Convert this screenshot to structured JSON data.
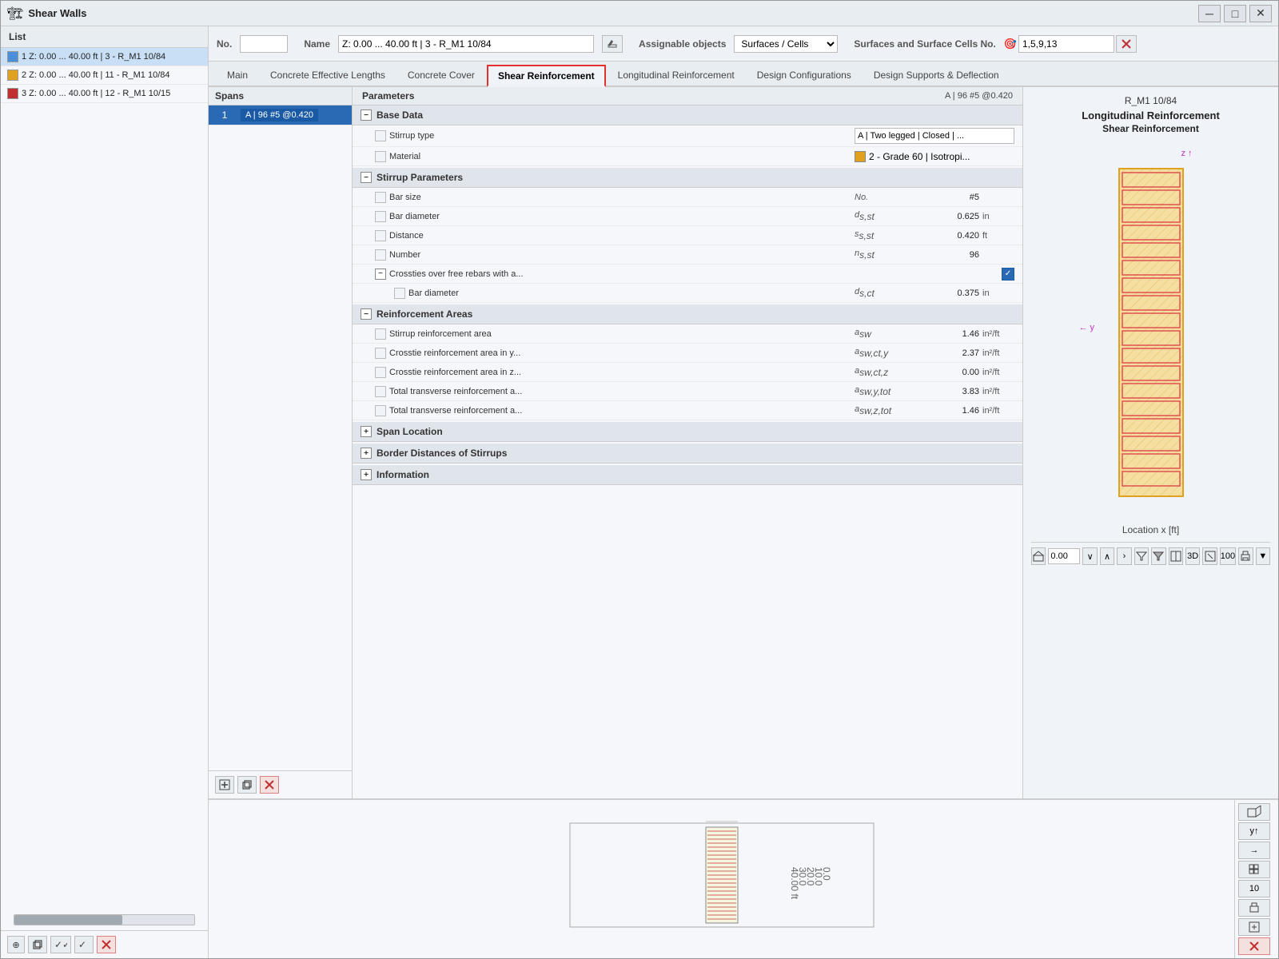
{
  "window": {
    "title": "Shear Walls",
    "icon": "🏗"
  },
  "titlebar_controls": {
    "minimize": "─",
    "maximize": "□",
    "close": "✕"
  },
  "top_bar": {
    "no_label": "No.",
    "name_label": "Name",
    "name_value": "Z: 0.00 ... 40.00 ft | 3 - R_M1 10/84",
    "assignable_label": "Assignable objects",
    "assignable_value": "Surfaces / Cells",
    "surfaces_label": "Surfaces and Surface Cells No.",
    "surfaces_value": "1,5,9,13"
  },
  "tabs": [
    {
      "id": "main",
      "label": "Main"
    },
    {
      "id": "concrete_effective",
      "label": "Concrete Effective Lengths"
    },
    {
      "id": "concrete_cover",
      "label": "Concrete Cover"
    },
    {
      "id": "shear_reinforcement",
      "label": "Shear Reinforcement",
      "active": true
    },
    {
      "id": "longitudinal_reinforcement",
      "label": "Longitudinal Reinforcement"
    },
    {
      "id": "design_configurations",
      "label": "Design Configurations"
    },
    {
      "id": "design_supports",
      "label": "Design Supports & Deflection"
    }
  ],
  "sidebar": {
    "header": "List",
    "items": [
      {
        "id": 1,
        "label": "1 Z: 0.00 ... 40.00 ft | 3 - R_M1 10/84",
        "color": "#4a90d9",
        "active": true
      },
      {
        "id": 2,
        "label": "2 Z: 0.00 ... 40.00 ft | 11 - R_M1 10/84",
        "color": "#e0a020"
      },
      {
        "id": 3,
        "label": "3 Z: 0.00 ... 40.00 ft | 12 - R_M1 10/15",
        "color": "#c03030"
      }
    ],
    "footer_btns": [
      "⊕",
      "📋",
      "✓✓",
      "✓",
      "✕"
    ]
  },
  "spans_panel": {
    "header": "Spans",
    "items": [
      {
        "num": 1,
        "label": "A | 96 #5 @0.420",
        "active": true
      }
    ]
  },
  "params_panel": {
    "header": "Parameters",
    "header_value": "A | 96 #5 @0.420",
    "rm_label": "R_M1 10/84",
    "sections": [
      {
        "id": "base_data",
        "label": "Base Data",
        "expanded": true,
        "rows": [
          {
            "label": "Stirrup type",
            "symbol": "",
            "value": "",
            "unit": "",
            "type": "input",
            "input_value": "A | Two legged | Closed | ..."
          },
          {
            "label": "Material",
            "symbol": "",
            "value": "",
            "unit": "",
            "type": "material",
            "material_label": "2 - Grade 60 | Isotropi..."
          }
        ]
      },
      {
        "id": "stirrup_parameters",
        "label": "Stirrup Parameters",
        "expanded": true,
        "rows": [
          {
            "label": "Bar size",
            "symbol": "No.",
            "value": "#5",
            "unit": "",
            "type": "value"
          },
          {
            "label": "Bar diameter",
            "symbol": "ds,st",
            "value": "0.625",
            "unit": "in",
            "type": "value"
          },
          {
            "label": "Distance",
            "symbol": "ss,st",
            "value": "0.420",
            "unit": "ft",
            "type": "value"
          },
          {
            "label": "Number",
            "symbol": "ns,st",
            "value": "96",
            "unit": "",
            "type": "value"
          },
          {
            "label": "Crossties over free rebars with a...",
            "symbol": "",
            "value": "☑",
            "unit": "",
            "type": "checkbox",
            "checked": true
          },
          {
            "label": "Bar diameter",
            "symbol": "ds,ct",
            "value": "0.375",
            "unit": "in",
            "type": "value",
            "indent": true
          }
        ]
      },
      {
        "id": "reinforcement_areas",
        "label": "Reinforcement Areas",
        "expanded": true,
        "rows": [
          {
            "label": "Stirrup reinforcement area",
            "symbol": "asw",
            "value": "1.46",
            "unit": "in²/ft",
            "type": "value"
          },
          {
            "label": "Crosstie reinforcement area in y...",
            "symbol": "asw,ct,y",
            "value": "2.37",
            "unit": "in²/ft",
            "type": "value"
          },
          {
            "label": "Crosstie reinforcement area in z...",
            "symbol": "asw,ct,z",
            "value": "0.00",
            "unit": "in²/ft",
            "type": "value"
          },
          {
            "label": "Total transverse reinforcement a...",
            "symbol": "asw,y,tot",
            "value": "3.83",
            "unit": "in²/ft",
            "type": "value"
          },
          {
            "label": "Total transverse reinforcement a...",
            "symbol": "asw,z,tot",
            "value": "1.46",
            "unit": "in²/ft",
            "type": "value"
          }
        ]
      },
      {
        "id": "span_location",
        "label": "Span Location",
        "expanded": false
      },
      {
        "id": "border_distances",
        "label": "Border Distances of Stirrups",
        "expanded": false
      },
      {
        "id": "information",
        "label": "Information",
        "expanded": false
      }
    ]
  },
  "viz_panel": {
    "title": "Longitudinal Reinforcement",
    "subtitle": "Shear Reinforcement",
    "axis_z": "z",
    "axis_y": "y",
    "location_label": "Location x [ft]",
    "location_value": "0.00"
  },
  "footer_btns": {
    "copy": "📋",
    "paste": "📋",
    "delete": "✕"
  },
  "bottom_right_tools": [
    "y↑",
    "→",
    "⊞",
    "10",
    "🖨",
    "⊡",
    "✕"
  ]
}
